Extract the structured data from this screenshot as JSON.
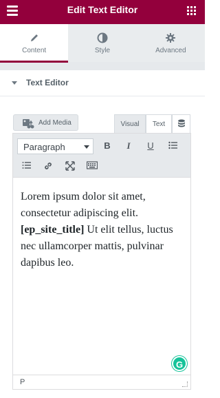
{
  "header": {
    "title": "Edit Text Editor",
    "menu_icon": "hamburger-menu-icon",
    "apps_icon": "grid-apps-icon",
    "accent_color": "#93003c"
  },
  "tabs": [
    {
      "label": "Content",
      "icon": "pencil-icon",
      "active": true
    },
    {
      "label": "Style",
      "icon": "half-circle-icon",
      "active": false
    },
    {
      "label": "Advanced",
      "icon": "gear-icon",
      "active": false
    }
  ],
  "section": {
    "title": "Text Editor",
    "expanded": true
  },
  "editor": {
    "add_media_label": "Add Media",
    "mode_tabs": {
      "visual": "Visual",
      "text": "Text"
    },
    "format_select": "Paragraph",
    "toolbar_buttons": [
      "B",
      "I",
      "U"
    ],
    "content": {
      "line1": "Lorem ipsum dolor sit amet, consectetur adipiscing elit.",
      "shortcode": "[ep_site_title]",
      "line2": "Ut elit tellus, luctus nec ullamcorper mattis, pulvinar dapibus leo."
    },
    "status_path": "P",
    "grammarly_label": "G"
  }
}
